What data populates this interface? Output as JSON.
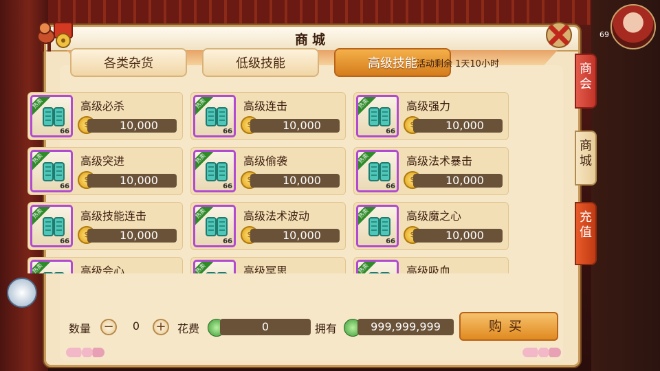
{
  "window": {
    "title": "商城"
  },
  "tabs": [
    {
      "label": "各类杂货",
      "active": false
    },
    {
      "label": "低级技能",
      "active": false
    },
    {
      "label": "高级技能",
      "active": true
    }
  ],
  "promo": {
    "text": "活动剩余 1天10小时"
  },
  "items": [
    {
      "name": "高级必杀",
      "price": "10,000",
      "badge": "热卖",
      "level": "66"
    },
    {
      "name": "高级连击",
      "price": "10,000",
      "badge": "热卖",
      "level": "66"
    },
    {
      "name": "高级强力",
      "price": "10,000",
      "badge": "热卖",
      "level": "66"
    },
    {
      "name": "高级突进",
      "price": "10,000",
      "badge": "热卖",
      "level": "66"
    },
    {
      "name": "高级偷袭",
      "price": "10,000",
      "badge": "热卖",
      "level": "66"
    },
    {
      "name": "高级法术暴击",
      "price": "10,000",
      "badge": "热卖",
      "level": "66"
    },
    {
      "name": "高级技能连击",
      "price": "10,000",
      "badge": "热卖",
      "level": "66"
    },
    {
      "name": "高级法术波动",
      "price": "10,000",
      "badge": "热卖",
      "level": "66"
    },
    {
      "name": "高级魔之心",
      "price": "10,000",
      "badge": "热卖",
      "level": "66"
    },
    {
      "name": "高级会心",
      "price": "",
      "badge": "热卖",
      "level": ""
    },
    {
      "name": "高级冥思",
      "price": "",
      "badge": "热卖",
      "level": ""
    },
    {
      "name": "高级吸血",
      "price": "",
      "badge": "热卖",
      "level": ""
    }
  ],
  "purchase": {
    "quantity_label": "数量",
    "quantity_value": "0",
    "minus": "−",
    "plus": "+",
    "cost_label": "花费",
    "cost_value": "0",
    "owned_label": "拥有",
    "owned_value": "999,999,999",
    "buy_label": "购买"
  },
  "side_tabs": {
    "shop": "商会",
    "mall": "商城",
    "recharge": "充值"
  },
  "avatar_level": "69",
  "colors": {
    "accent": "#d57c1c",
    "panel": "#f4e4c4",
    "price_bar": "#6a5238",
    "rarity_border": "#b04ad0"
  }
}
